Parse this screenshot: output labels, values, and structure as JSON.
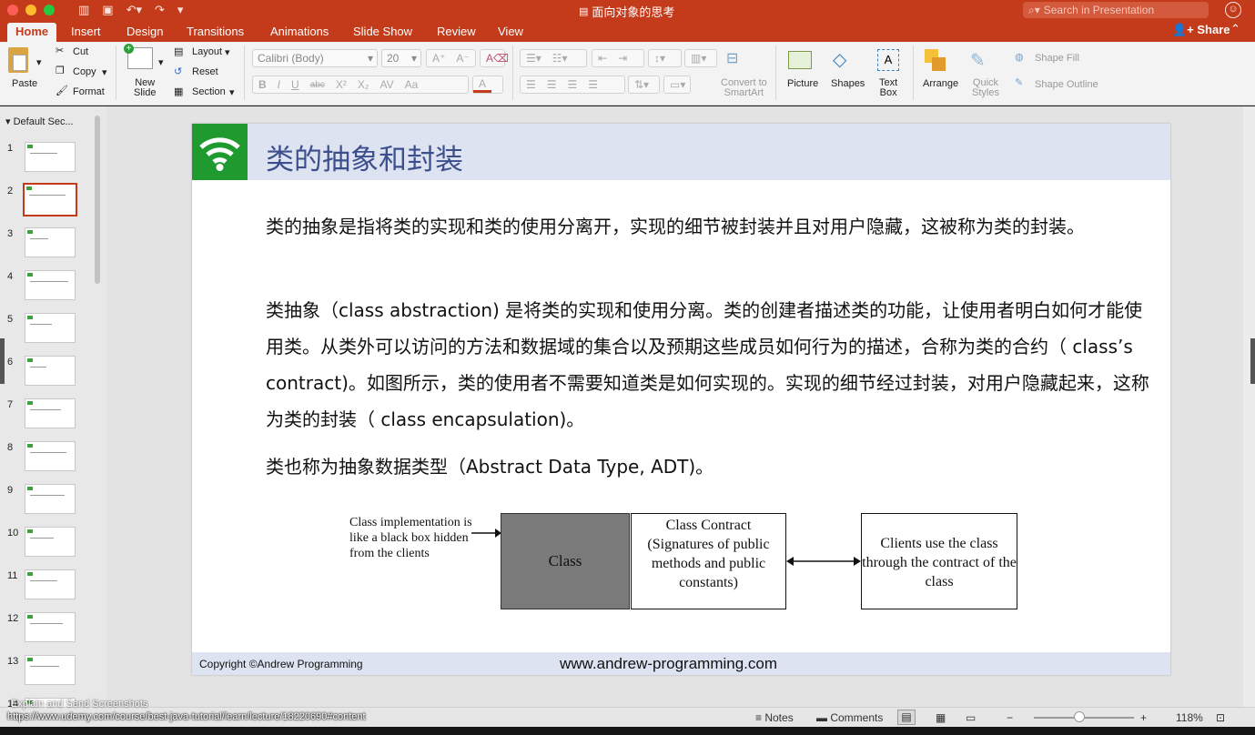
{
  "window": {
    "title": "面向对象的思考",
    "search_placeholder": "Search in Presentation"
  },
  "tabs": [
    {
      "label": "Home",
      "active": true
    },
    {
      "label": "Insert"
    },
    {
      "label": "Design"
    },
    {
      "label": "Transitions"
    },
    {
      "label": "Animations"
    },
    {
      "label": "Slide Show"
    },
    {
      "label": "Review"
    },
    {
      "label": "View"
    }
  ],
  "share_label": "Share",
  "ribbon": {
    "paste": "Paste",
    "cut": "Cut",
    "copy": "Copy",
    "format": "Format",
    "new_slide_1": "New",
    "new_slide_2": "Slide",
    "layout": "Layout",
    "reset": "Reset",
    "section": "Section",
    "font": "Calibri (Body)",
    "size": "20",
    "convert_1": "Convert to",
    "convert_2": "SmartArt",
    "picture": "Picture",
    "shapes": "Shapes",
    "textbox_1": "Text",
    "textbox_2": "Box",
    "arrange": "Arrange",
    "quick_1": "Quick",
    "quick_2": "Styles",
    "shape_fill": "Shape Fill",
    "shape_outline": "Shape Outline"
  },
  "panel": {
    "section": "Default Sec...",
    "slides": [
      "1",
      "2",
      "3",
      "4",
      "5",
      "6",
      "7",
      "8",
      "9",
      "10",
      "11",
      "12",
      "13",
      "14"
    ],
    "selected": "2"
  },
  "slide": {
    "title": "类的抽象和封装",
    "p1": "类的抽象是指将类的实现和类的使用分离开，实现的细节被封装并且对用户隐藏，这被称为类的封装。",
    "p2": "类抽象（class abstraction) 是将类的实现和使用分离。类的创建者描述类的功能，让使用者明白如何才能使用类。从类外可以访问的方法和数据域的集合以及预期这些成员如何行为的描述，合称为类的合约（ class’s contract)。如图所示，类的使用者不需要知道类是如何实现的。实现的细节经过封装，对用户隐藏起来，这称为类的封装（ class encapsulation)。",
    "p3": "类也称为抽象数据类型（Abstract Data Type, ADT)。",
    "diagram": {
      "note": "Class implementation is like a black box hidden from the clients",
      "class": "Class",
      "contract": "Class Contract (Signatures of public methods and public constants)",
      "clients": "Clients use the class through the contract of the class"
    },
    "copyright": "Copyright ©Andrew Programming",
    "site": "www.andrew-programming.com"
  },
  "status": {
    "notes": "Notes",
    "comments": "Comments",
    "zoom": "118%",
    "zoom_level": 0.45
  },
  "overlay": {
    "helper": "Explain and Send Screenshots",
    "url": "https://www.udemy.com/course/best-java-tutorial/learn/lecture/18220690#content"
  }
}
